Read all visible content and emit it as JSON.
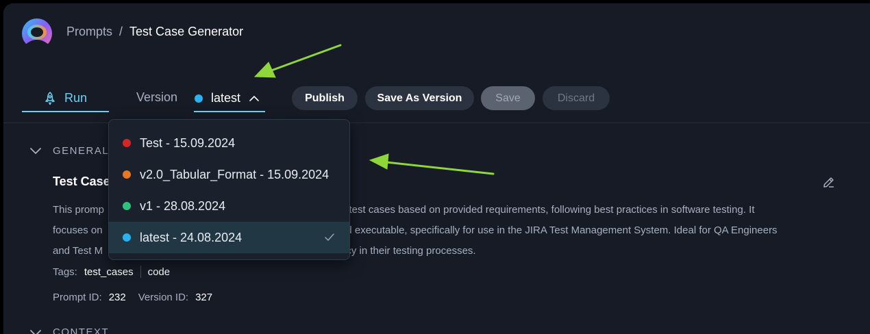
{
  "breadcrumb": {
    "parent": "Prompts",
    "separator": "/",
    "current": "Test Case Generator"
  },
  "toolbar": {
    "run_label": "Run",
    "version_label": "Version",
    "version_value": "latest",
    "publish_label": "Publish",
    "save_as_version_label": "Save As Version",
    "save_label": "Save",
    "discard_label": "Discard"
  },
  "version_dropdown": {
    "items": [
      {
        "label": "Test - 15.09.2024",
        "dot_color": "#d62525"
      },
      {
        "label": "v2.0_Tabular_Format - 15.09.2024",
        "dot_color": "#e8771f"
      },
      {
        "label": "v1 - 28.08.2024",
        "dot_color": "#2ec27e"
      },
      {
        "label": "latest - 24.08.2024",
        "dot_color": "#2ab2f0",
        "selected": true
      }
    ]
  },
  "general": {
    "section_title": "GENERAL",
    "prompt_name": "Test Case",
    "description_lines": [
      "This promp",
      "d test cases based on provided requirements, following best practices in software testing. It",
      "focuses on",
      "nd executable, specifically for use in the JIRA Test Management System. Ideal for QA Engineers",
      "and Test M",
      "ncy in their testing processes."
    ],
    "tags_label": "Tags:",
    "tags": [
      "test_cases",
      "code"
    ],
    "prompt_id_label": "Prompt ID:",
    "prompt_id": "232",
    "version_id_label": "Version ID:",
    "version_id": "327"
  },
  "context": {
    "section_title": "CONTEXT"
  },
  "icons": {
    "logo": "app-logo",
    "run": "rocket-icon",
    "version_toggle": "chevron-up-icon",
    "section_toggle": "chevron-down-icon",
    "edit": "pencil-icon",
    "selected_mark": "check-icon"
  },
  "colors": {
    "accent": "#6ad3f5",
    "annotation_arrow": "#8fd63a"
  }
}
